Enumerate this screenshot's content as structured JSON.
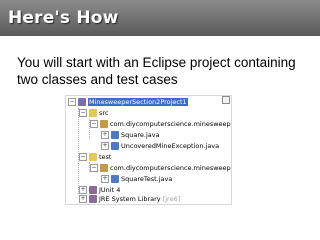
{
  "slide": {
    "title": "Here's How",
    "body": "You will start with an Eclipse project containing two classes and test cases"
  },
  "tree": {
    "project": "MinesweeperSection2Project1",
    "src": "src",
    "package_main": "com.diycomputerscience.minesweeper",
    "file_square": "Square.java",
    "file_uncovered": "UncoveredMineException.java",
    "test": "test",
    "package_test": "com.diycomputerscience.minesweeper",
    "file_squaretest": "SquareTest.java",
    "junit": "JUnit 4",
    "jre": "JRE System Library",
    "jre_suffix": "[jre6]"
  },
  "colors": {
    "title_bar": "#6e6e6e",
    "selection": "#3d6bd0"
  }
}
